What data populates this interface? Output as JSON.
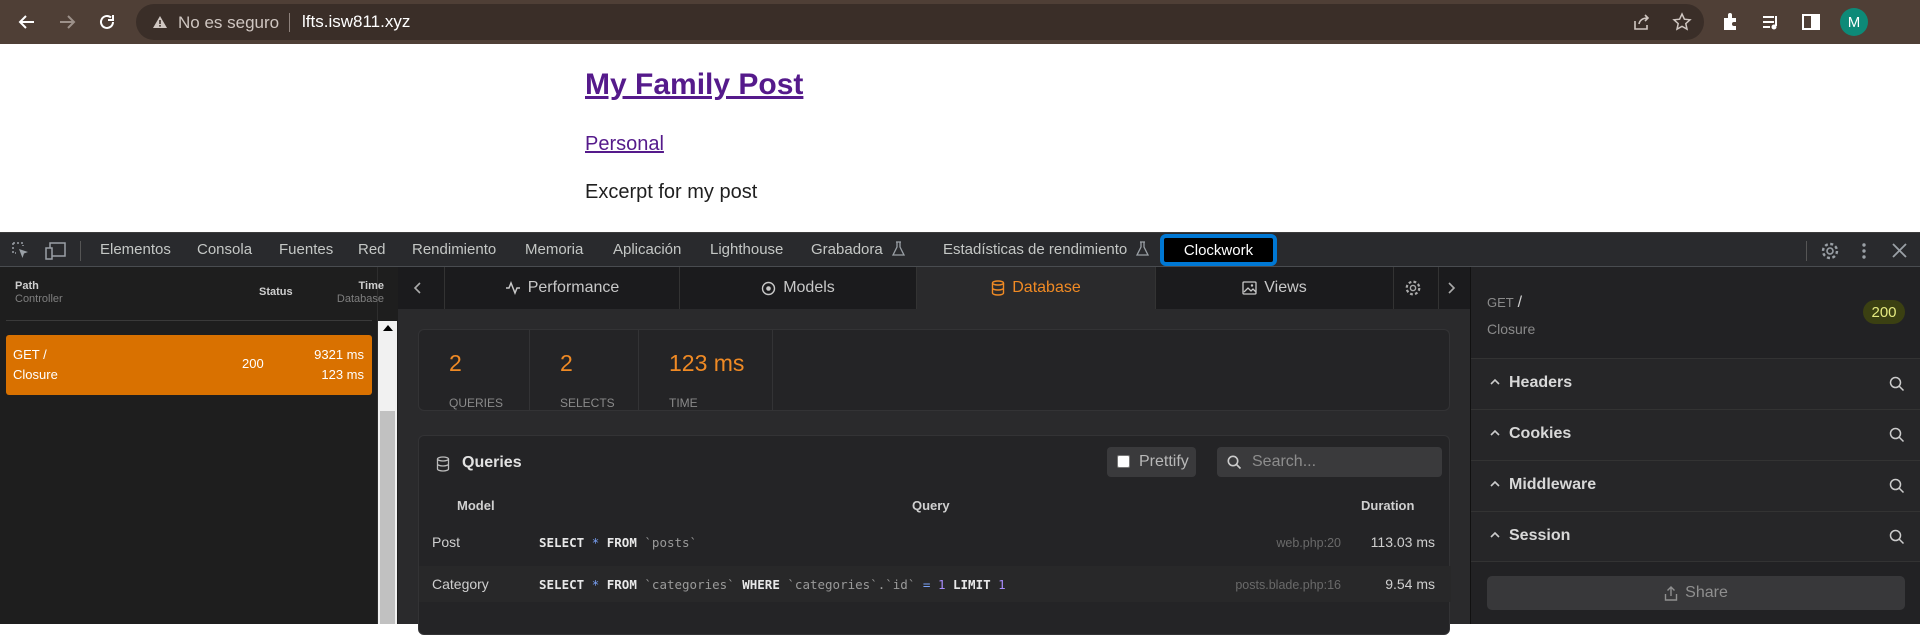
{
  "browser": {
    "insecure_label": "No es seguro",
    "url": "lfts.isw811.xyz",
    "avatar_letter": "M"
  },
  "page": {
    "title": "My Family Post",
    "category": "Personal",
    "excerpt": "Excerpt for my post"
  },
  "devtools": {
    "tabs": [
      "Elementos",
      "Consola",
      "Fuentes",
      "Red",
      "Rendimiento",
      "Memoria",
      "Aplicación",
      "Lighthouse",
      "Grabadora",
      "Estadísticas de rendimiento",
      "Clockwork"
    ],
    "active_tab": "Clockwork",
    "highlight_color": "#0078d4"
  },
  "clockwork": {
    "list_headers": {
      "path": "Path",
      "controller": "Controller",
      "status": "Status",
      "time": "Time",
      "database": "Database"
    },
    "request": {
      "method_path": "GET /",
      "controller": "Closure",
      "status": "200",
      "time": "9321 ms",
      "db_time": "123 ms"
    },
    "tabs": [
      "Performance",
      "Models",
      "Database",
      "Views"
    ],
    "active_tab": "Database",
    "accent": "#f08a24",
    "stats": [
      {
        "value": "2",
        "label": "QUERIES"
      },
      {
        "value": "2",
        "label": "SELECTS"
      },
      {
        "value": "123 ms",
        "label": "TIME"
      }
    ],
    "queries": {
      "title": "Queries",
      "prettify_label": "Prettify",
      "search_placeholder": "Search...",
      "columns": [
        "Model",
        "Query",
        "Duration"
      ],
      "rows": [
        {
          "model": "Post",
          "file": "web.php:20",
          "duration": "113.03 ms"
        },
        {
          "model": "Category",
          "file": "posts.blade.php:16",
          "duration": "9.54 ms"
        }
      ],
      "sql_tokens": {
        "select": "SELECT",
        "star": "*",
        "from": "FROM",
        "posts_table": "`posts`",
        "categories_table": "`categories`",
        "where": "WHERE",
        "column": "`categories`.`id`",
        "eq": "=",
        "one": "1",
        "limit": "LIMIT",
        "limit_value": "1"
      }
    },
    "sidebar": {
      "method": "GET",
      "path": "/",
      "controller": "Closure",
      "status": "200",
      "sections": [
        "Headers",
        "Cookies",
        "Middleware",
        "Session"
      ],
      "share_label": "Share"
    }
  }
}
